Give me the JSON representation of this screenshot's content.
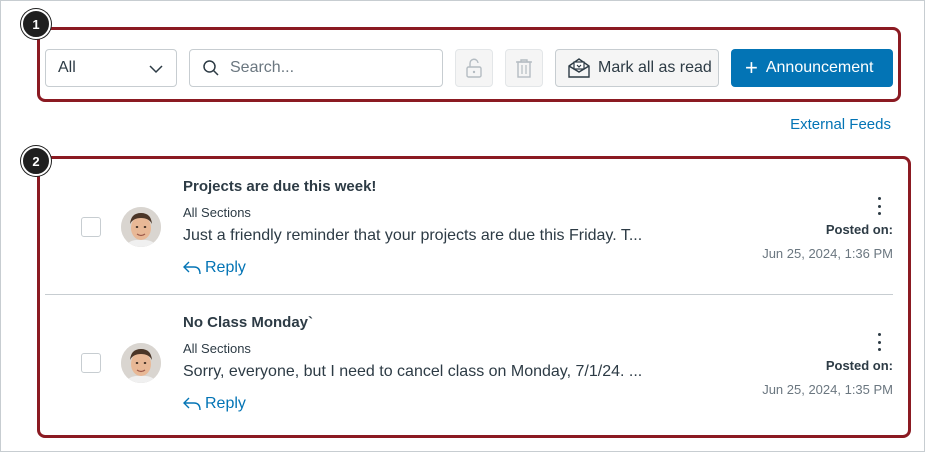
{
  "callouts": [
    "1",
    "2"
  ],
  "toolbar": {
    "filter_selected": "All",
    "search_placeholder": "Search...",
    "mark_all_label": "Mark all as read",
    "announcement_label": "Announcement",
    "accent_color": "#0374b5"
  },
  "external_feeds_label": "External Feeds",
  "announcements": [
    {
      "title": "Projects are due this week!",
      "section": "All Sections",
      "preview": "Just a friendly reminder that your projects are due this Friday. T...",
      "reply_label": "Reply",
      "posted_label": "Posted on:",
      "posted_date": "Jun 25, 2024, 1:36 PM"
    },
    {
      "title": "No Class Monday`",
      "section": "All Sections",
      "preview": "Sorry, everyone, but I need to cancel class on Monday, 7/1/24. ...",
      "reply_label": "Reply",
      "posted_label": "Posted on:",
      "posted_date": "Jun 25, 2024, 1:35 PM"
    }
  ]
}
